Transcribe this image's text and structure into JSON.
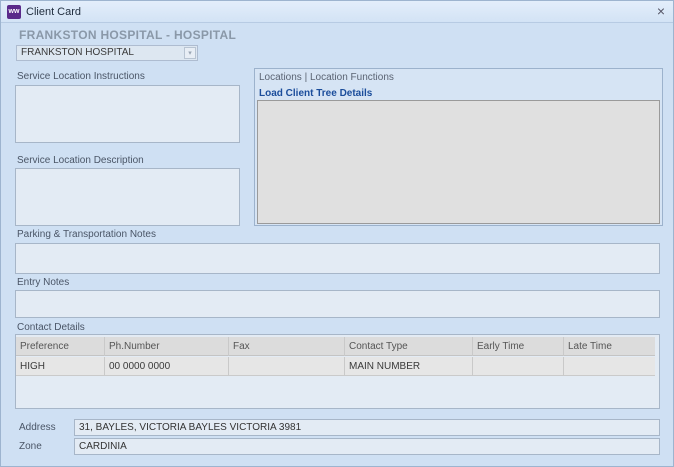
{
  "window": {
    "title": "Client Card",
    "icon_text": "ww",
    "close_glyph": "×"
  },
  "header": {
    "hospital_title": "FRANKSTON HOSPITAL  - HOSPITAL",
    "location_select_value": "FRANKSTON HOSPITAL",
    "select_arrow": "▾"
  },
  "labels": {
    "service_location_instructions": "Service Location Instructions",
    "service_location_description": "Service Location Description",
    "parking_notes": "Parking & Transportation Notes",
    "entry_notes": "Entry Notes",
    "contact_details": "Contact Details",
    "address": "Address",
    "zone": "Zone"
  },
  "locations": {
    "title": "Locations | Location Functions",
    "load_link": "Load Client Tree Details"
  },
  "contact_grid": {
    "columns": [
      "Preference",
      "Ph.Number",
      "Fax",
      "Contact Type",
      "Early Time",
      "Late Time"
    ],
    "rows": [
      [
        "HIGH",
        "00 0000 0000",
        "",
        "MAIN NUMBER",
        "",
        ""
      ]
    ]
  },
  "fields": {
    "address": "31, BAYLES, VICTORIA  BAYLES VICTORIA 3981",
    "zone": "CARDINIA"
  },
  "colors": {
    "window_bg": "#cfe0f3",
    "link": "#1b4d9b"
  }
}
